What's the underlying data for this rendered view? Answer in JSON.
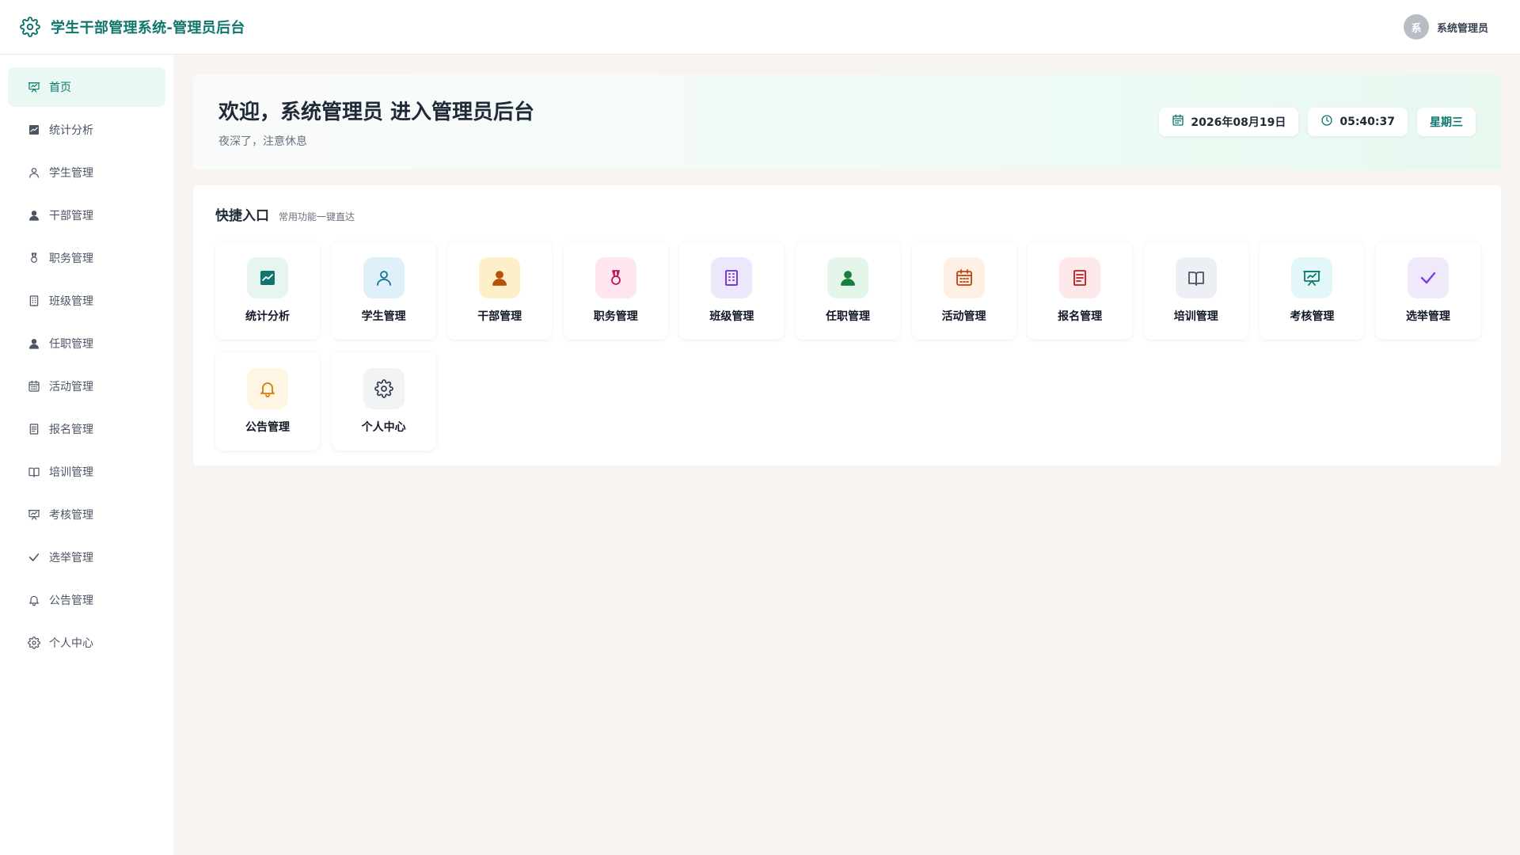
{
  "header": {
    "title": "学生干部管理系统-管理员后台",
    "user_avatar_text": "系",
    "user_name": "系统管理员"
  },
  "sidebar": {
    "items": [
      {
        "label": "首页",
        "icon": "presentation-icon",
        "active": true
      },
      {
        "label": "统计分析",
        "icon": "chart-icon"
      },
      {
        "label": "学生管理",
        "icon": "user-icon"
      },
      {
        "label": "干部管理",
        "icon": "user-solid-icon"
      },
      {
        "label": "职务管理",
        "icon": "medal-icon"
      },
      {
        "label": "班级管理",
        "icon": "building-icon"
      },
      {
        "label": "任职管理",
        "icon": "user-solid-icon"
      },
      {
        "label": "活动管理",
        "icon": "calendar-icon"
      },
      {
        "label": "报名管理",
        "icon": "document-icon"
      },
      {
        "label": "培训管理",
        "icon": "book-icon"
      },
      {
        "label": "考核管理",
        "icon": "presentation-icon"
      },
      {
        "label": "选举管理",
        "icon": "check-icon"
      },
      {
        "label": "公告管理",
        "icon": "bell-icon"
      },
      {
        "label": "个人中心",
        "icon": "gear-icon"
      }
    ]
  },
  "welcome": {
    "title": "欢迎，系统管理员 进入管理员后台",
    "subtitle": "夜深了，注意休息",
    "date": "2026年08月19日",
    "time": "05:40:37",
    "weekday": "星期三"
  },
  "quick": {
    "title": "快捷入口",
    "subtitle": "常用功能一键直达",
    "tiles": [
      {
        "label": "统计分析",
        "icon": "chart-icon",
        "bg": "#e6f6ef",
        "fg": "#0f766e"
      },
      {
        "label": "学生管理",
        "icon": "user-icon",
        "bg": "#e0f0fb",
        "fg": "#0e7490"
      },
      {
        "label": "干部管理",
        "icon": "user-solid-icon",
        "bg": "#fdf0c8",
        "fg": "#b45309"
      },
      {
        "label": "职务管理",
        "icon": "medal-icon",
        "bg": "#fde6ef",
        "fg": "#be185d"
      },
      {
        "label": "班级管理",
        "icon": "building-icon",
        "bg": "#ede7fb",
        "fg": "#6d28d9"
      },
      {
        "label": "任职管理",
        "icon": "user-solid-icon",
        "bg": "#e4f6ea",
        "fg": "#15803d"
      },
      {
        "label": "活动管理",
        "icon": "calendar-icon",
        "bg": "#fff0e6",
        "fg": "#c2410c"
      },
      {
        "label": "报名管理",
        "icon": "document-icon",
        "bg": "#fde9ea",
        "fg": "#b91c1c"
      },
      {
        "label": "培训管理",
        "icon": "book-icon",
        "bg": "#eceff3",
        "fg": "#475569"
      },
      {
        "label": "考核管理",
        "icon": "presentation-icon",
        "bg": "#e3f7f8",
        "fg": "#0f766e"
      },
      {
        "label": "选举管理",
        "icon": "check-icon",
        "bg": "#efe9fb",
        "fg": "#7c3aed"
      },
      {
        "label": "公告管理",
        "icon": "bell-icon",
        "bg": "#fff5e3",
        "fg": "#d97706"
      },
      {
        "label": "个人中心",
        "icon": "gear-icon",
        "bg": "#f1f3f5",
        "fg": "#374151"
      }
    ]
  },
  "colors": {
    "accent": "#0f766e",
    "active_bg": "#e9f8f2",
    "page_bg": "#f7f4f1"
  }
}
